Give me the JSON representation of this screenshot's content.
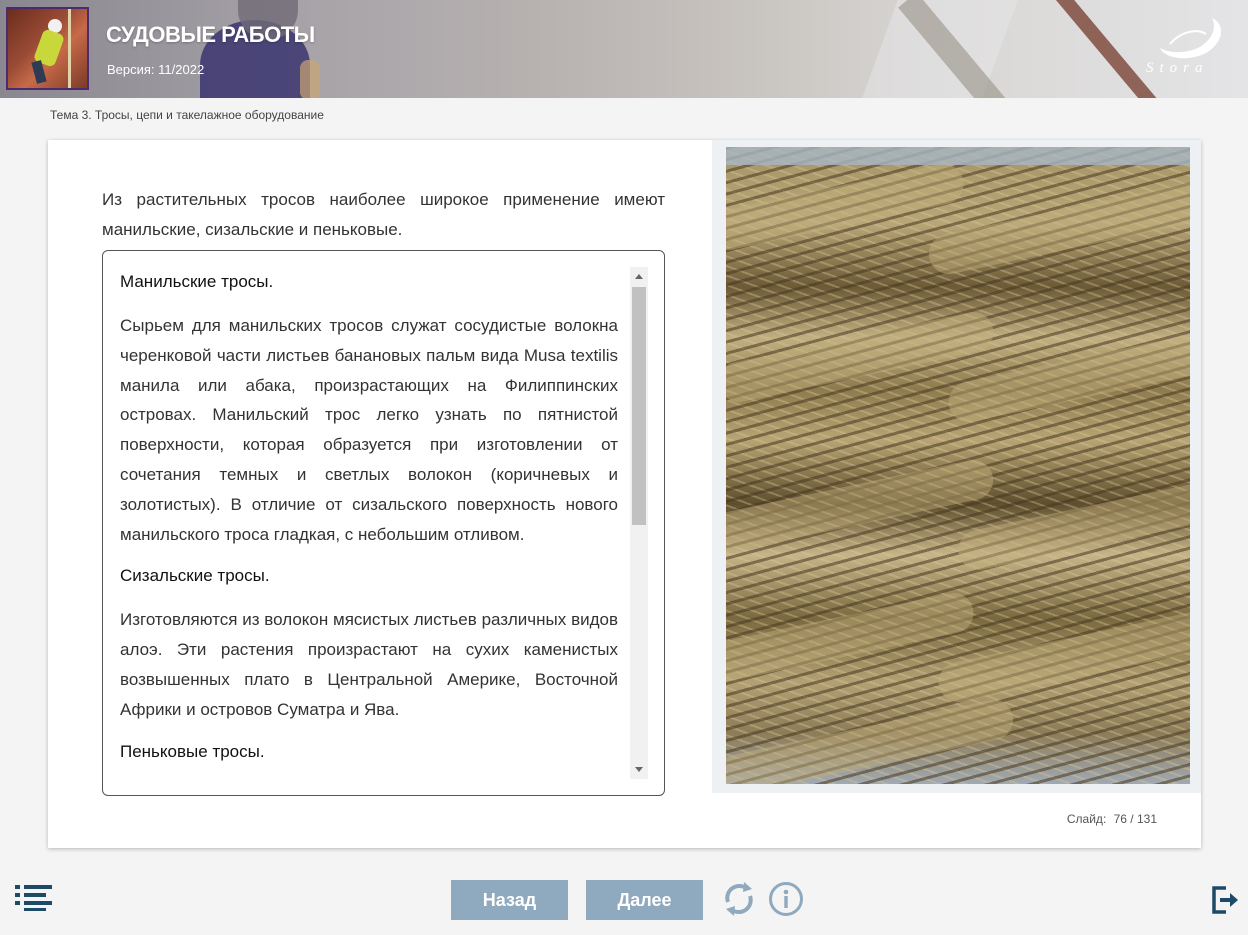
{
  "header": {
    "title": "СУДОВЫЕ РАБОТЫ",
    "version": "Версия: 11/2022",
    "logo_text": "Stora"
  },
  "breadcrumb": "Тема 3. Тросы, цепи и такелажное оборудование",
  "slide": {
    "intro": "Из растительных тросов наиболее широкое применение имеют манильские, сизальские и пеньковые.",
    "sections": [
      {
        "heading": "Манильские тросы.",
        "text": "Сырьем для манильских тросов служат сосудистые волокна черенковой части листьев банановых пальм вида Musa textilis манила или абака, произрастающих на Филиппинских островах. Манильский трос легко узнать по пятнистой поверхности, которая образуется при изготовлении от сочетания темных и светлых волокон (коричневых и золотистых). В отличие от сизальского поверхность нового манильского троса гладкая, с небольшим отливом."
      },
      {
        "heading": "Сизальские тросы.",
        "text": "Изготовляются из волокон мясистых листьев различных видов алоэ. Эти растения произрастают на сухих каменистых возвышенных плато в Центральной Америке, Восточной Африки и островов Суматра и Ява."
      },
      {
        "heading": "Пеньковые тросы.",
        "text": ""
      }
    ],
    "slide_label": "Слайд:",
    "slide_number": "76 / 131"
  },
  "nav": {
    "back_label": "Назад",
    "next_label": "Далее",
    "accent_color": "#8fa9bf",
    "icon_color": "#1d4a66"
  }
}
